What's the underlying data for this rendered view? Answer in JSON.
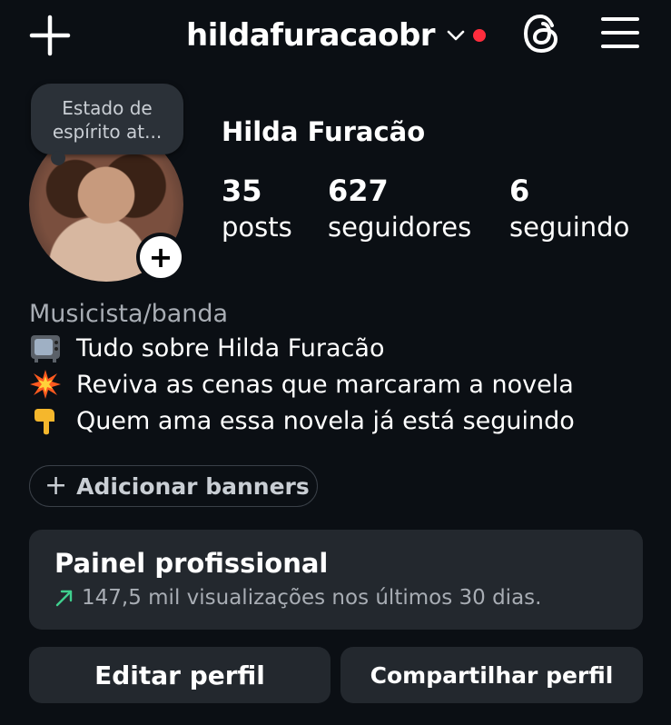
{
  "header": {
    "username": "hildafuracaobr",
    "notification_color": "#ff2d3d"
  },
  "profile": {
    "note": "Estado de espírito at...",
    "display_name": "Hilda Furacão",
    "stats": [
      {
        "value": "35",
        "label": "posts"
      },
      {
        "value": "627",
        "label": "seguidores"
      },
      {
        "value": "6",
        "label": "seguindo"
      }
    ],
    "category": "Musicista/banda",
    "bio": [
      {
        "icon": "tv-emoji",
        "text": "Tudo sobre Hilda Furacão"
      },
      {
        "icon": "collision-emoji",
        "text": "Reviva as cenas que marcaram a novela"
      },
      {
        "icon": "pointing-down-emoji",
        "text": "Quem ama essa novela já está seguindo"
      }
    ]
  },
  "banners_button": {
    "label": "Adicionar banners"
  },
  "pro_panel": {
    "title": "Painel profissional",
    "subtitle": "147,5 mil visualizações nos últimos 30 dias.",
    "trend_color": "#3fcf8e"
  },
  "actions": {
    "edit_label": "Editar perfil",
    "share_label": "Compartilhar perfil"
  }
}
